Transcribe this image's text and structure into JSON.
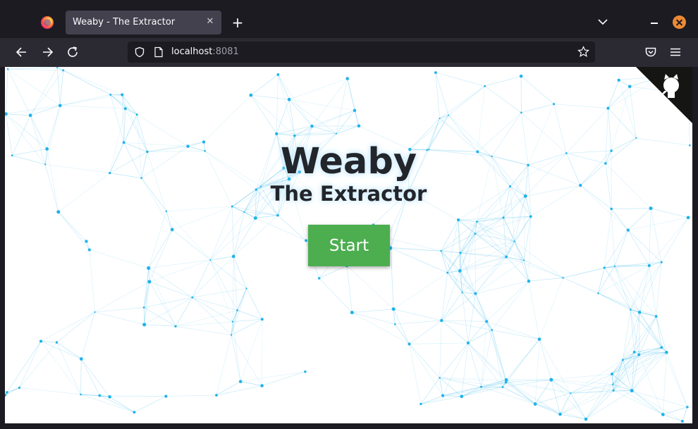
{
  "browser": {
    "tab": {
      "title": "Weaby - The Extractor"
    },
    "address": {
      "host": "localhost",
      "port": ":8081"
    }
  },
  "page": {
    "title": "Weaby",
    "subtitle": "The Extractor",
    "start_label": "Start"
  },
  "colors": {
    "accent": "#4cae4f",
    "network_line": "#5cc5ee",
    "network_node": "#1fb3ea"
  }
}
